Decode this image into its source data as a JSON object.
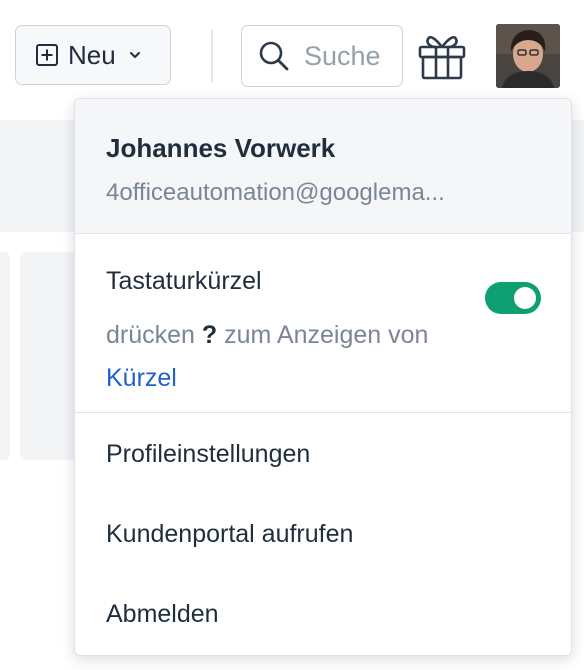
{
  "topbar": {
    "new_label": "Neu",
    "search_placeholder": "Suche",
    "icons": [
      "plus-square-icon",
      "chevron-down-icon",
      "search-icon",
      "gift-icon"
    ]
  },
  "menu": {
    "user_name": "Johannes Vorwerk",
    "user_email": "4officeautomation@googlema...",
    "shortcuts": {
      "title": "Tastaturkürzel",
      "desc_before": "drücken",
      "key": "?",
      "desc_after": "zum Anzeigen von",
      "link": "Kürzel",
      "enabled": true
    },
    "items": [
      "Profileinstellungen",
      "Kundenportal aufrufen",
      "Abmelden"
    ]
  },
  "colors": {
    "toggle_on": "#0e9f73",
    "link": "#1f62c9",
    "text": "#1f2d3d",
    "muted": "#7b8694"
  }
}
